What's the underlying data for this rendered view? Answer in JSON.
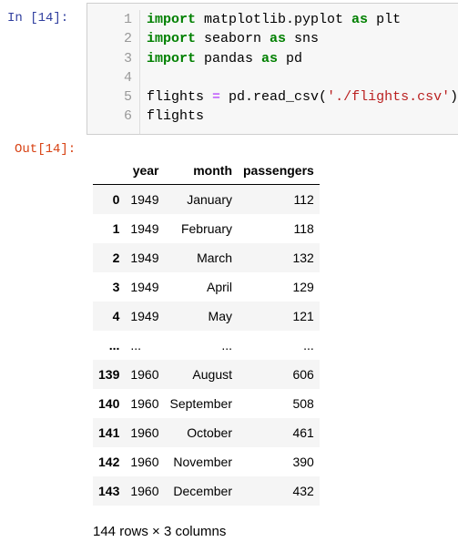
{
  "cell": {
    "in_prompt": "In  [14]:",
    "out_prompt": "Out[14]:",
    "line_numbers": [
      "1",
      "2",
      "3",
      "4",
      "5",
      "6"
    ],
    "code": [
      [
        {
          "t": "import",
          "c": "kw"
        },
        {
          "t": " matplotlib.pyplot ",
          "c": ""
        },
        {
          "t": "as",
          "c": "kw"
        },
        {
          "t": " plt",
          "c": ""
        }
      ],
      [
        {
          "t": "import",
          "c": "kw"
        },
        {
          "t": " seaborn ",
          "c": ""
        },
        {
          "t": "as",
          "c": "kw"
        },
        {
          "t": " sns",
          "c": ""
        }
      ],
      [
        {
          "t": "import",
          "c": "kw"
        },
        {
          "t": " pandas ",
          "c": ""
        },
        {
          "t": "as",
          "c": "kw"
        },
        {
          "t": " pd",
          "c": ""
        }
      ],
      [],
      [
        {
          "t": "flights ",
          "c": ""
        },
        {
          "t": "=",
          "c": "op"
        },
        {
          "t": " pd.read_csv(",
          "c": ""
        },
        {
          "t": "'./flights.csv'",
          "c": "str"
        },
        {
          "t": ")",
          "c": ""
        }
      ],
      [
        {
          "t": "flights",
          "c": ""
        }
      ]
    ]
  },
  "table": {
    "columns": [
      "",
      "year",
      "month",
      "passengers"
    ],
    "rows": [
      [
        "0",
        "1949",
        "January",
        "112"
      ],
      [
        "1",
        "1949",
        "February",
        "118"
      ],
      [
        "2",
        "1949",
        "March",
        "132"
      ],
      [
        "3",
        "1949",
        "April",
        "129"
      ],
      [
        "4",
        "1949",
        "May",
        "121"
      ],
      [
        "...",
        "...",
        "...",
        "..."
      ],
      [
        "139",
        "1960",
        "August",
        "606"
      ],
      [
        "140",
        "1960",
        "September",
        "508"
      ],
      [
        "141",
        "1960",
        "October",
        "461"
      ],
      [
        "142",
        "1960",
        "November",
        "390"
      ],
      [
        "143",
        "1960",
        "December",
        "432"
      ]
    ]
  },
  "footer": "144 rows × 3 columns"
}
